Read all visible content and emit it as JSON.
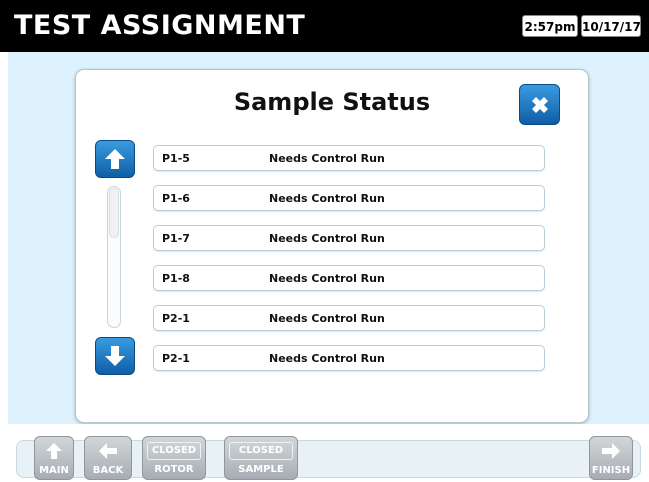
{
  "header": {
    "title": "TEST ASSIGNMENT",
    "time": "2:57pm",
    "date": "10/17/17"
  },
  "dialog": {
    "title": "Sample Status",
    "close_icon": "close-x-icon",
    "rows": [
      {
        "id": "P1-5",
        "status": "Needs Control Run"
      },
      {
        "id": "P1-6",
        "status": "Needs Control Run"
      },
      {
        "id": "P1-7",
        "status": "Needs Control Run"
      },
      {
        "id": "P1-8",
        "status": "Needs Control Run"
      },
      {
        "id": "P2-1",
        "status": "Needs Control Run"
      },
      {
        "id": "P2-1",
        "status": "Needs Control Run"
      }
    ]
  },
  "nav": {
    "main": "MAIN",
    "back": "BACK",
    "rotor": {
      "state": "CLOSED",
      "label": "ROTOR"
    },
    "sample": {
      "state": "CLOSED",
      "label": "SAMPLE"
    },
    "finish": "FINISH"
  },
  "colors": {
    "accent_blue": "#1a75c2",
    "background": "#ddf2fc",
    "disabled_gray": "#a6adb2"
  }
}
